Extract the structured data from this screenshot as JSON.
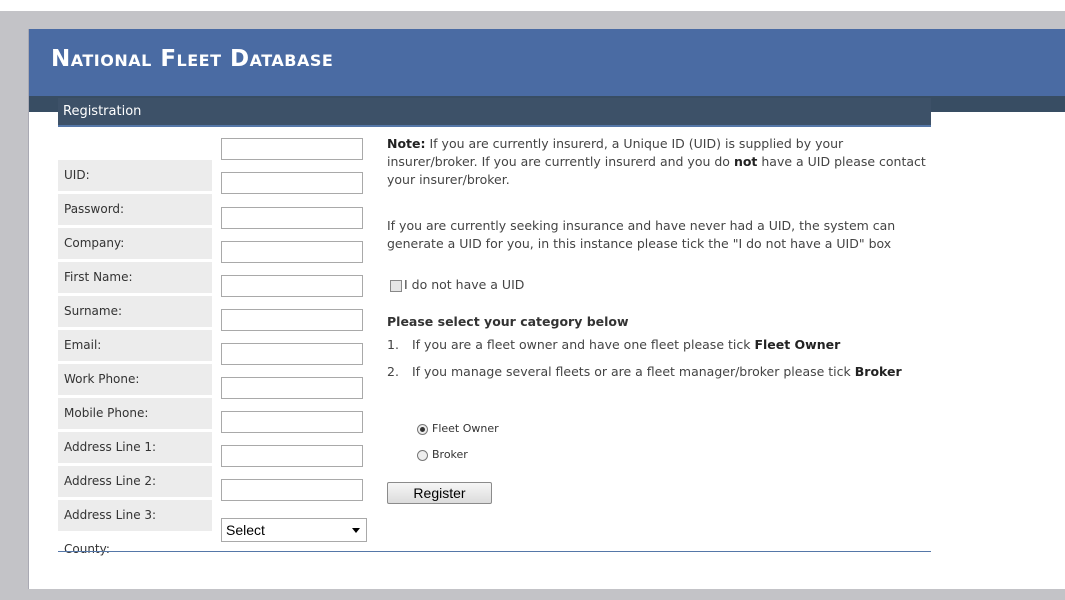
{
  "header": {
    "title": "National Fleet Database"
  },
  "panel": {
    "title": "Registration"
  },
  "form": {
    "fields": [
      {
        "label": "UID:",
        "value": ""
      },
      {
        "label": "Password:",
        "value": ""
      },
      {
        "label": "Company:",
        "value": ""
      },
      {
        "label": "First Name:",
        "value": ""
      },
      {
        "label": "Surname:",
        "value": ""
      },
      {
        "label": "Email:",
        "value": ""
      },
      {
        "label": "Work Phone:",
        "value": ""
      },
      {
        "label": "Mobile Phone:",
        "value": ""
      },
      {
        "label": "Address Line 1:",
        "value": ""
      },
      {
        "label": "Address Line 2:",
        "value": ""
      },
      {
        "label": "Address Line 3:",
        "value": ""
      }
    ],
    "county": {
      "label": "County:",
      "selected": "Select"
    }
  },
  "info": {
    "note_label": "Note:",
    "note_text_1": " If you are currently insurerd, a Unique ID (UID) is supplied by your insurer/broker. If you are currently insurerd and you do ",
    "note_emph": "not",
    "note_text_2": " have a UID please contact your insurer/broker.",
    "paragraph2": "If you are currently seeking insurance and have never had a UID, the system can generate a UID for you, in this instance please tick the \"I do not have a UID\" box",
    "no_uid_checkbox": {
      "label": "I do not have a UID",
      "checked": false
    },
    "category_heading": "Please select your category below",
    "items": [
      {
        "num": "1.",
        "text": "If you are a fleet owner and have one fleet please tick ",
        "emph": "Fleet Owner"
      },
      {
        "num": "2.",
        "text": "If you manage several fleets or are a fleet manager/broker please tick ",
        "emph": "Broker"
      }
    ],
    "radios": [
      {
        "label": "Fleet Owner",
        "checked": true
      },
      {
        "label": "Broker",
        "checked": false
      }
    ]
  },
  "actions": {
    "register_label": "Register"
  }
}
